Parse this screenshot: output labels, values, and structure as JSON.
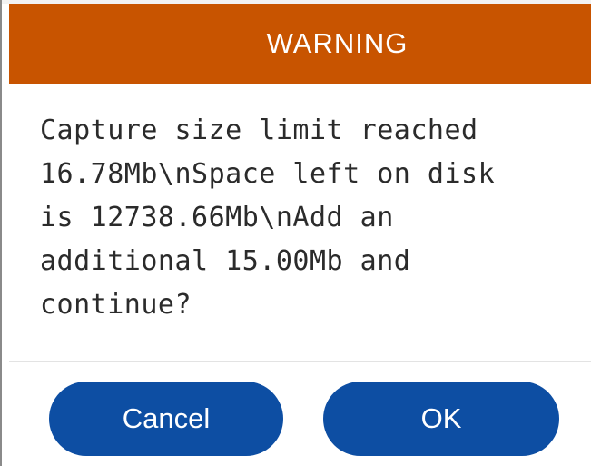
{
  "dialog": {
    "title": "WARNING",
    "message": "Capture size limit reached\n16.78Mb\\nSpace left on disk\nis 12738.66Mb\\nAdd an\nadditional 15.00Mb and\ncontinue?",
    "buttons": {
      "cancel_label": "Cancel",
      "ok_label": "OK"
    }
  },
  "colors": {
    "header_background": "#c85400",
    "button_background": "#0d4ea3",
    "text": "#2b2b2b"
  }
}
